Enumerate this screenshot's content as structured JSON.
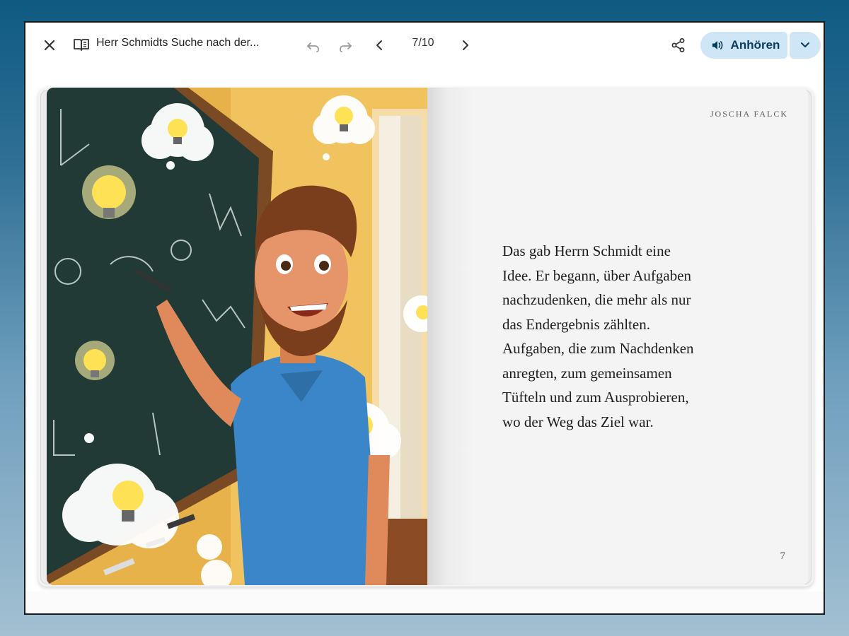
{
  "toolbar": {
    "title": "Herr Schmidts Suche nach der...",
    "page_counter": "7/10",
    "listen_label": "Anhören",
    "icons": [
      "close-icon",
      "book-icon",
      "undo-icon",
      "redo-icon",
      "chevron-left-icon",
      "chevron-right-icon",
      "share-icon",
      "speaker-icon",
      "chevron-down-icon"
    ]
  },
  "page": {
    "author": "JOSCHA FALCK",
    "story_lines": [
      "Das gab Herrn Schmidt eine",
      "Idee. Er begann, über Aufgaben",
      "nachzudenken, die mehr als nur",
      "das Endergebnis zählten.",
      "Aufgaben, die zum Nachdenken",
      "anregten, zum gemeinsamen",
      "Tüfteln und zum Ausprobieren,",
      "wo der Weg das Ziel war."
    ],
    "page_number": "7"
  },
  "colors": {
    "accent_button": "#cfe6f7",
    "accent_text": "#0a3a5c",
    "chalkboard": "#213a36",
    "wall": "#e7b24a",
    "shirt": "#3a86c8"
  }
}
